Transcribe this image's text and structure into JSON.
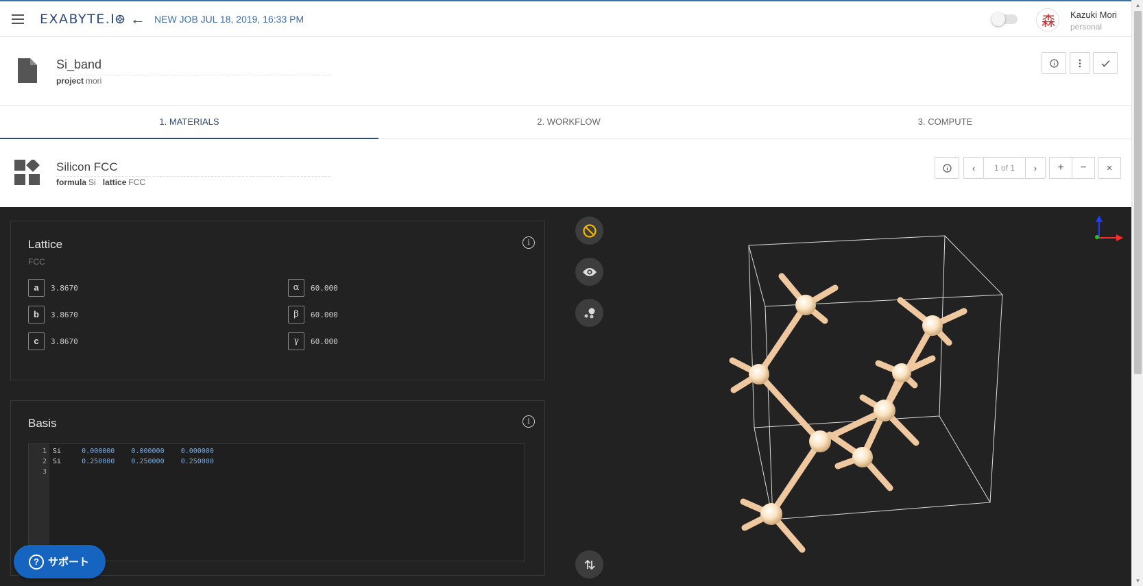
{
  "topbar": {
    "logo_text": "EXABYTE.I",
    "job_title": "NEW JOB JUL 18, 2019, 16:33 PM",
    "user_name": "Kazuki Mori",
    "user_account": "personal",
    "avatar_glyph": "森",
    "accent_color": "#2d4a7a"
  },
  "job": {
    "name": "Si_band",
    "project_label": "project",
    "project_value": "mori",
    "actions": [
      "info-icon",
      "more-vert-icon",
      "check-icon"
    ]
  },
  "tabs": [
    {
      "label": "1. MATERIALS",
      "active": true
    },
    {
      "label": "2. WORKFLOW",
      "active": false
    },
    {
      "label": "3. COMPUTE",
      "active": false
    }
  ],
  "material": {
    "name": "Silicon FCC",
    "formula_label": "formula",
    "formula_value": "Si",
    "lattice_label": "lattice",
    "lattice_value": "FCC",
    "pager": "1 of 1"
  },
  "lattice_panel": {
    "title": "Lattice",
    "type": "FCC",
    "params": [
      {
        "key": "a",
        "value": "3.8670"
      },
      {
        "key": "b",
        "value": "3.8670"
      },
      {
        "key": "c",
        "value": "3.8670"
      }
    ],
    "angles": [
      {
        "key": "α",
        "value": "60.000"
      },
      {
        "key": "β",
        "value": "60.000"
      },
      {
        "key": "γ",
        "value": "60.000"
      }
    ]
  },
  "basis_panel": {
    "title": "Basis",
    "lines": [
      {
        "n": "1",
        "el": "Si",
        "x": "0.000000",
        "y": "0.000000",
        "z": "0.000000"
      },
      {
        "n": "2",
        "el": "Si",
        "x": "0.250000",
        "y": "0.250000",
        "z": "0.250000"
      },
      {
        "n": "3",
        "el": "",
        "x": "",
        "y": "",
        "z": ""
      }
    ]
  },
  "support": {
    "label": "サポート"
  },
  "colors": {
    "dark_bg": "#222222",
    "bond": "#f0c8a0",
    "atom": "#fff0d8"
  }
}
